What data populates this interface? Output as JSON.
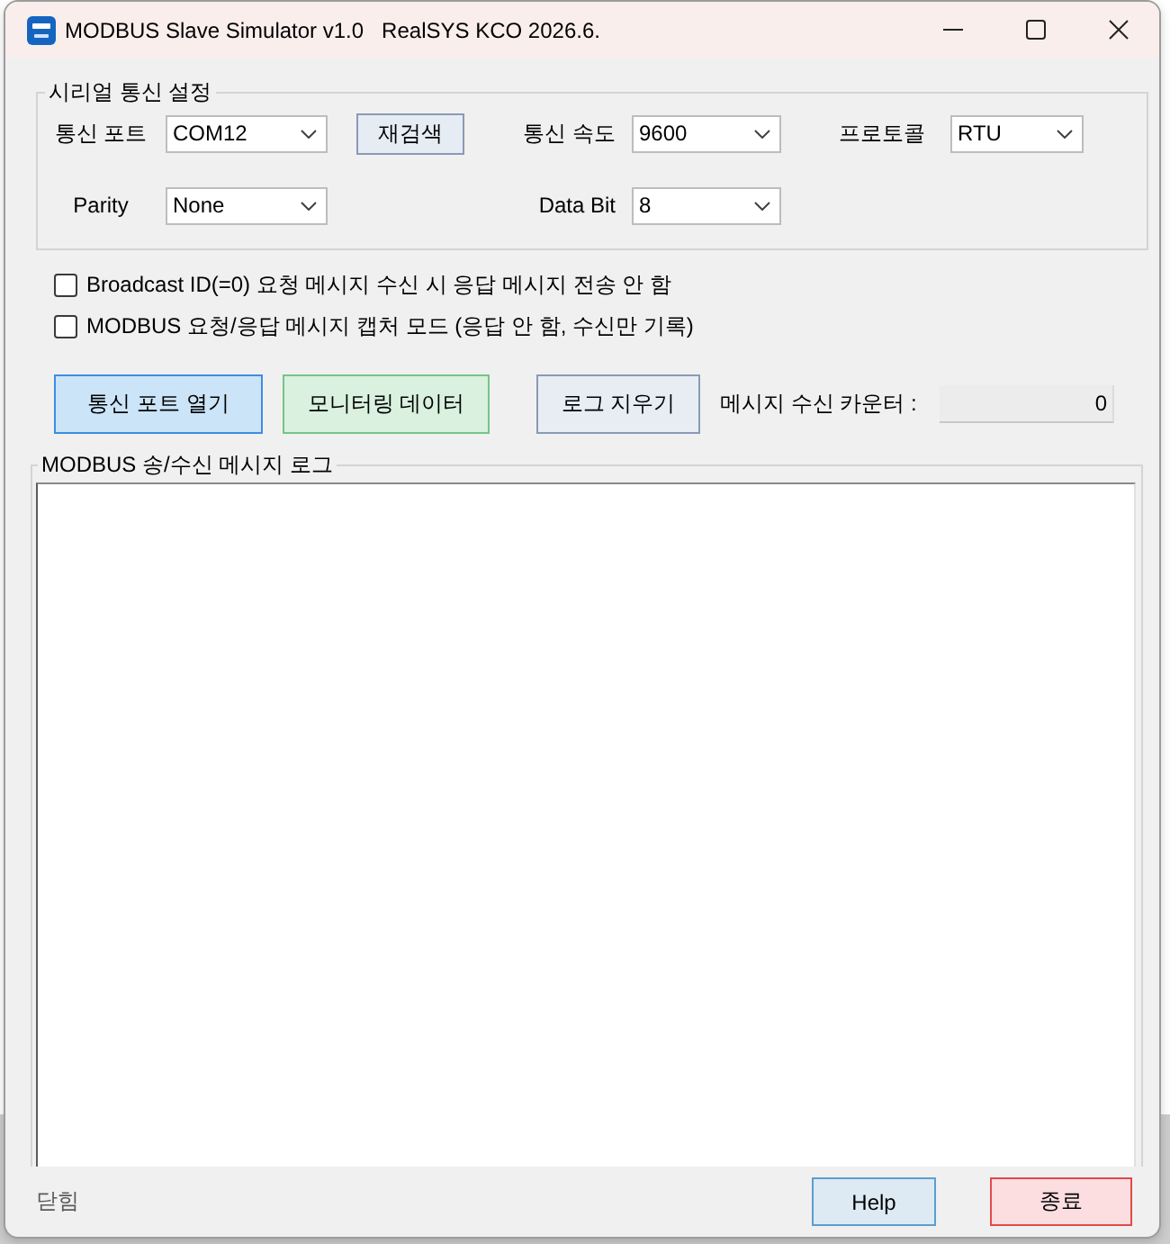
{
  "window": {
    "title": "MODBUS Slave Simulator v1.0   RealSYS KCO 2026.6."
  },
  "serial_settings": {
    "title": "시리얼 통신 설정",
    "port": {
      "label": "통신 포트",
      "value": "COM12"
    },
    "rescan_button": {
      "label": "재검색"
    },
    "baud_rate": {
      "label": "통신 속도",
      "value": "9600"
    },
    "protocol": {
      "label": "프로토콜",
      "value": "RTU"
    },
    "parity": {
      "label": "Parity",
      "value": "None"
    },
    "data_bit": {
      "label": "Data Bit",
      "value": "8"
    }
  },
  "options": [
    {
      "label": "Broadcast ID(=0) 요청 메시지 수신 시 응답 메시지 전송 안 함",
      "checked": false
    },
    {
      "label": "MODBUS 요청/응답 메시지 캡처 모드 (응답 안 함, 수신만 기록)",
      "checked": false
    }
  ],
  "actions": [
    {
      "label": "통신 포트 열기",
      "kind": "accent"
    },
    {
      "label": "모니터링 데이터",
      "kind": "success"
    },
    {
      "label": "로그 지우기",
      "kind": "plain"
    }
  ],
  "counter": {
    "label": "메시지 수신 카운터 :",
    "value": "0"
  },
  "log": {
    "title": "MODBUS 송/수신 메시지 로그"
  },
  "status_bar": {
    "status": "닫힘",
    "buttons": [
      {
        "label": "Help",
        "kind": "info"
      },
      {
        "label": "종료",
        "kind": "danger"
      }
    ]
  }
}
